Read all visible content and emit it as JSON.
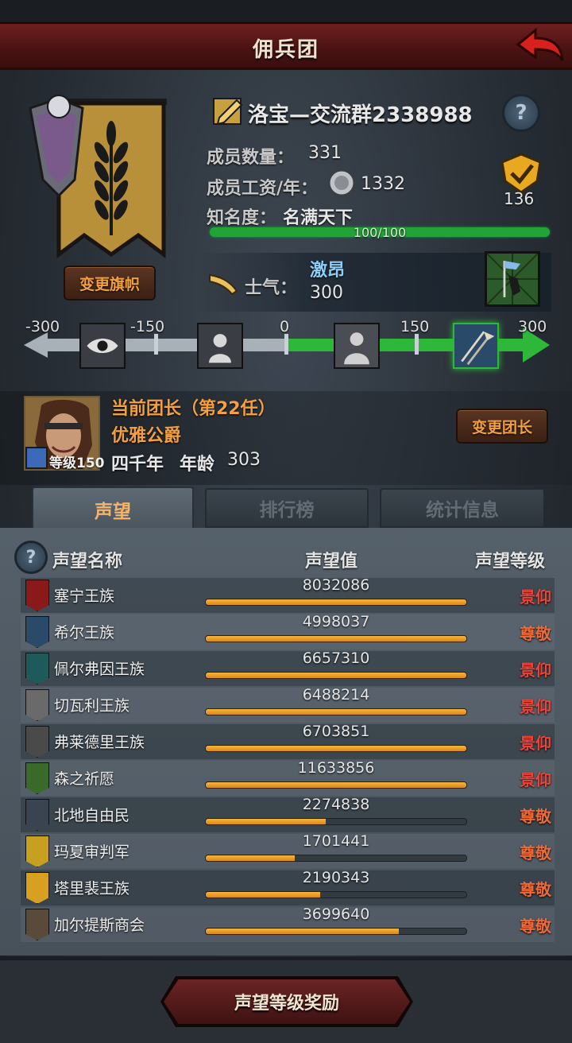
{
  "header": {
    "title": "佣兵团"
  },
  "guild": {
    "name": "洛宝—交流群2338988",
    "members_label": "成员数量：",
    "members_value": "331",
    "salary_label": "成员工资/年：",
    "salary_value": "1332",
    "fame_label": "知名度：",
    "fame_value": "名满天下",
    "fame_progress_text": "100/100",
    "fame_progress": 1.0,
    "badge_count": "136",
    "change_banner_label": "变更旗帜"
  },
  "morale": {
    "label": "士气：",
    "state": "激昂",
    "value": "300",
    "scale_ticks": [
      "-300",
      "-150",
      "0",
      "150",
      "300"
    ]
  },
  "leader": {
    "title": "当前团长（第22任）",
    "name": "优雅公爵",
    "level_label": "等级150",
    "era": "四千年",
    "age_label": "年龄",
    "age_value": "303",
    "change_leader_label": "变更团长"
  },
  "tabs": [
    {
      "label": "声望",
      "active": true
    },
    {
      "label": "排行榜",
      "active": false
    },
    {
      "label": "统计信息",
      "active": false
    }
  ],
  "table": {
    "headers": {
      "name": "声望名称",
      "value": "声望值",
      "level": "声望等级"
    },
    "rows": [
      {
        "name": "塞宁王族",
        "value": "8032086",
        "fill": 1.0,
        "level": "景仰",
        "icon_color": "#8a1a1a"
      },
      {
        "name": "希尔王族",
        "value": "4998037",
        "fill": 1.0,
        "level": "尊敬",
        "icon_color": "#2a4a6a"
      },
      {
        "name": "佩尔弗因王族",
        "value": "6657310",
        "fill": 1.0,
        "level": "景仰",
        "icon_color": "#1e5a5a"
      },
      {
        "name": "切瓦利王族",
        "value": "6488214",
        "fill": 1.0,
        "level": "景仰",
        "icon_color": "#6a6a6a"
      },
      {
        "name": "弗莱德里王族",
        "value": "6703851",
        "fill": 1.0,
        "level": "景仰",
        "icon_color": "#4a4a4a"
      },
      {
        "name": "森之祈愿",
        "value": "11633856",
        "fill": 1.0,
        "level": "景仰",
        "icon_color": "#3a6a2a"
      },
      {
        "name": "北地自由民",
        "value": "2274838",
        "fill": 0.46,
        "level": "尊敬",
        "icon_color": "#3a4450"
      },
      {
        "name": "玛夏审判军",
        "value": "1701441",
        "fill": 0.34,
        "level": "尊敬",
        "icon_color": "#c8a020"
      },
      {
        "name": "塔里裴王族",
        "value": "2190343",
        "fill": 0.44,
        "level": "尊敬",
        "icon_color": "#d8a020"
      },
      {
        "name": "加尔提斯商会",
        "value": "3699640",
        "fill": 0.74,
        "level": "尊敬",
        "icon_color": "#5a4a3a"
      }
    ]
  },
  "reward_button": {
    "label": "声望等级奖励"
  },
  "colors": {
    "level_high": "#e8463a",
    "level_mid": "#ec6a3a",
    "accent_orange": "#f2a040",
    "progress_green": "#22a336"
  }
}
